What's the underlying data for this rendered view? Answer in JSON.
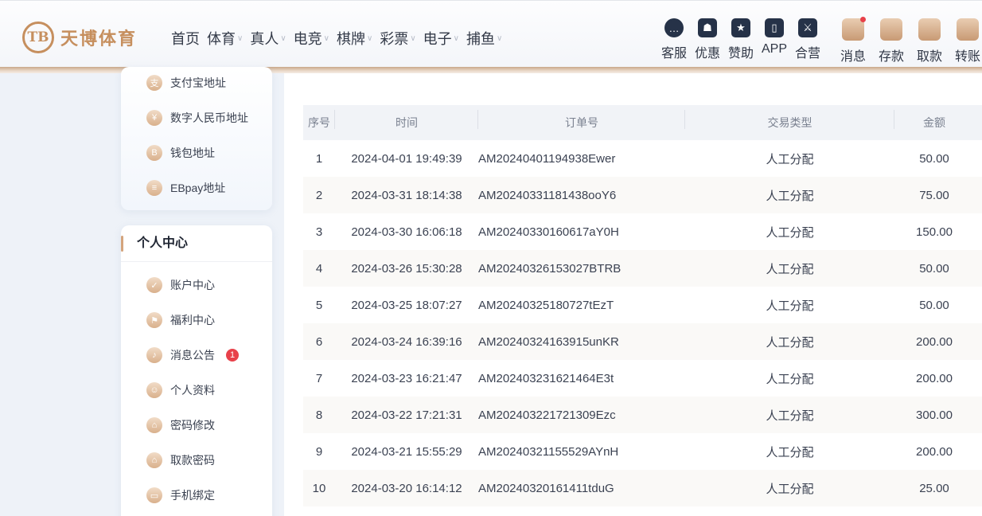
{
  "brand": {
    "logo_mark": "TB",
    "name": "天博体育"
  },
  "nav": [
    {
      "label": "首页",
      "dropdown": false
    },
    {
      "label": "体育",
      "dropdown": true
    },
    {
      "label": "真人",
      "dropdown": true
    },
    {
      "label": "电竞",
      "dropdown": true
    },
    {
      "label": "棋牌",
      "dropdown": true
    },
    {
      "label": "彩票",
      "dropdown": true
    },
    {
      "label": "电子",
      "dropdown": true
    },
    {
      "label": "捕鱼",
      "dropdown": true
    }
  ],
  "tools": [
    {
      "label": "客服",
      "icon": "chat-icon"
    },
    {
      "label": "优惠",
      "icon": "gift-icon"
    },
    {
      "label": "赞助",
      "icon": "bookmark-star-icon"
    },
    {
      "label": "APP",
      "icon": "phone-icon"
    },
    {
      "label": "合营",
      "icon": "handshake-icon"
    },
    {
      "label": "消息",
      "icon": "message-icon",
      "dot": true
    },
    {
      "label": "存款",
      "icon": "deposit-icon"
    },
    {
      "label": "取款",
      "icon": "withdraw-icon"
    },
    {
      "label": "转账",
      "icon": "transfer-icon"
    }
  ],
  "sidebar": {
    "wallet_items": [
      {
        "label": "支付宝地址",
        "icon": "alipay-icon"
      },
      {
        "label": "数字人民币地址",
        "icon": "digital-rmb-icon"
      },
      {
        "label": "钱包地址",
        "icon": "wallet-icon"
      },
      {
        "label": "EBpay地址",
        "icon": "ebpay-icon"
      }
    ],
    "personal_title": "个人中心",
    "personal_items": [
      {
        "label": "账户中心",
        "icon": "account-icon"
      },
      {
        "label": "福利中心",
        "icon": "welfare-icon"
      },
      {
        "label": "消息公告",
        "icon": "bell-icon",
        "badge": "1"
      },
      {
        "label": "个人资料",
        "icon": "profile-icon"
      },
      {
        "label": "密码修改",
        "icon": "lock-icon"
      },
      {
        "label": "取款密码",
        "icon": "lock-key-icon"
      },
      {
        "label": "手机绑定",
        "icon": "mobile-icon"
      }
    ]
  },
  "table": {
    "headers": [
      "序号",
      "时间",
      "订单号",
      "交易类型",
      "金额"
    ],
    "rows": [
      [
        "1",
        "2024-04-01 19:49:39",
        "AM20240401194938Ewer",
        "人工分配",
        "50.00"
      ],
      [
        "2",
        "2024-03-31 18:14:38",
        "AM20240331181438ooY6",
        "人工分配",
        "75.00"
      ],
      [
        "3",
        "2024-03-30 16:06:18",
        "AM20240330160617aY0H",
        "人工分配",
        "150.00"
      ],
      [
        "4",
        "2024-03-26 15:30:28",
        "AM20240326153027BTRB",
        "人工分配",
        "50.00"
      ],
      [
        "5",
        "2024-03-25 18:07:27",
        "AM20240325180727tEzT",
        "人工分配",
        "50.00"
      ],
      [
        "6",
        "2024-03-24 16:39:16",
        "AM20240324163915unKR",
        "人工分配",
        "200.00"
      ],
      [
        "7",
        "2024-03-23 16:21:47",
        "AM202403231621464E3t",
        "人工分配",
        "200.00"
      ],
      [
        "8",
        "2024-03-22 17:21:31",
        "AM202403221721309Ezc",
        "人工分配",
        "300.00"
      ],
      [
        "9",
        "2024-03-21 15:55:29",
        "AM20240321155529AYnH",
        "人工分配",
        "200.00"
      ],
      [
        "10",
        "2024-03-20 16:14:12",
        "AM20240320161411tduG",
        "人工分配",
        "25.00"
      ]
    ]
  },
  "colors": {
    "accent": "#c68f5e",
    "badge": "#e8414a",
    "nav_text": "#333a48"
  }
}
